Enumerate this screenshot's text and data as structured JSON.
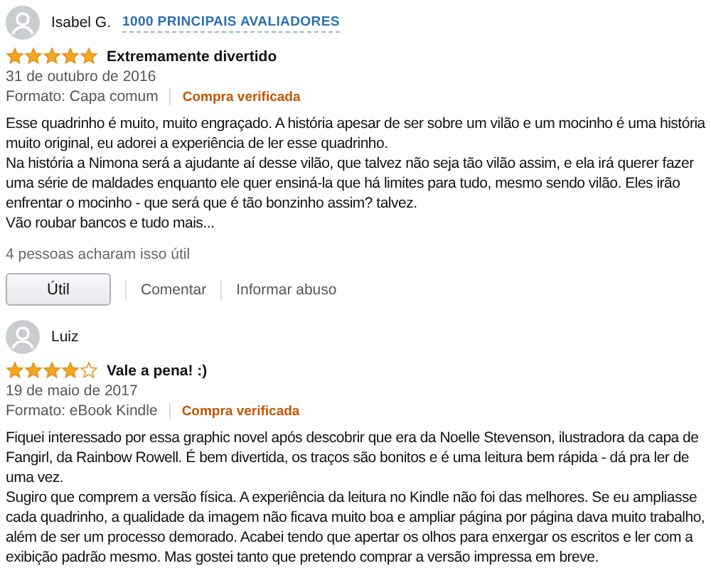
{
  "reviews": [
    {
      "author": "Isabel G.",
      "badge": "1000 PRINCIPAIS AVALIADORES",
      "stars": 5,
      "title": "Extremamente divertido",
      "date": "31 de outubro de 2016",
      "format": "Formato: Capa comum",
      "verified": "Compra verificada",
      "paragraphs": [
        "Esse quadrinho é muito, muito engraçado. A história apesar de ser sobre um vilão e um mocinho é uma história muito original, eu adorei a experiência de ler esse quadrinho.",
        "Na história a Nimona será a ajudante aí desse vilão, que talvez não seja tão vilão assim, e ela irá querer fazer uma série de maldades enquanto ele quer ensiná-la que há limites para tudo, mesmo sendo vilão. Eles irão enfrentar o mocinho - que será que é tão bonzinho assim? talvez.",
        "Vão roubar bancos e tudo mais..."
      ],
      "helpful": "4 pessoas acharam isso útil",
      "actions": {
        "button": "Útil",
        "links": [
          "Comentar",
          "Informar abuso"
        ]
      }
    },
    {
      "author": "Luiz",
      "stars": 4,
      "title": "Vale a pena! :)",
      "date": "19 de maio de 2017",
      "format": "Formato: eBook Kindle",
      "verified": "Compra verificada",
      "paragraphs": [
        "Fiquei interessado por essa graphic novel após descobrir que era da Noelle Stevenson, ilustradora da capa de Fangirl, da Rainbow Rowell. É bem divertida, os traços são bonitos e é uma leitura bem rápida - dá pra ler de uma vez.",
        "Sugiro que comprem a versão física. A experiência da leitura no Kindle não foi das melhores. Se eu ampliasse cada quadrinho, a qualidade da imagem não ficava muito boa e ampliar página por página dava muito trabalho, além de ser um processo demorado. Acabei tendo que apertar os olhos para enxergar os escritos e ler com a exibição padrão mesmo. Mas gostei tanto que pretendo comprar a versão impressa em breve."
      ]
    }
  ]
}
